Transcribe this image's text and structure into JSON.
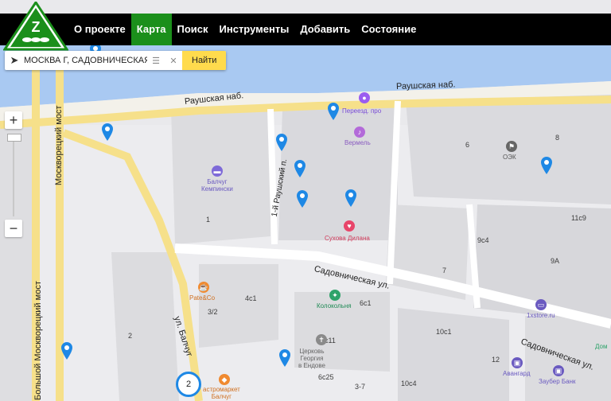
{
  "nav": {
    "items": [
      "О проекте",
      "Карта",
      "Поиск",
      "Инструменты",
      "Добавить",
      "Состояние"
    ],
    "active_index": 1
  },
  "search": {
    "value": "МОСКВА Г, САДОВНИЧЕСКАЯ",
    "button_label": "Найти"
  },
  "zoom": {
    "plus": "+",
    "minus": "−"
  },
  "map": {
    "streets": {
      "raushskaya_1": "Раушская наб.",
      "raushskaya_2": "Раушская наб.",
      "bolshoy_mosk": "Большой Москворецкий мост",
      "moskvoretsky": "Москворецкий мост",
      "raushsky_per": "1-й Раушский п.",
      "sadovnicheskaya_1": "Садовническая ул.",
      "sadovnicheskaya_2": "Садовническая ул.",
      "balchug": "ул. Балчуг"
    },
    "pois": {
      "pereezd": "Переезд. про",
      "vermel": "Вермель",
      "baltchug_kempinski": "Балчуг\nКемпински",
      "sukhova": "Сухова Дилана",
      "pate": "Pate&Co",
      "kolokolnya": "Колокольня",
      "church": "Церковь\nГеоргия\nв Ендове",
      "gastro": "астромаркет\nБалчуг",
      "oek": "ОЭК",
      "avangard": "Авангард",
      "zauber": "Заубер Банк",
      "store1x": "1xstore.ru",
      "dom": "Дом"
    },
    "house_numbers": {
      "h1": "1",
      "h2": "2",
      "h32": "3/2",
      "h4c1": "4с1",
      "h6": "6",
      "h8": "8",
      "h11c9": "11с9",
      "h9c4": "9с4",
      "h9a": "9А",
      "h7": "7",
      "h6c1": "6с1",
      "h10c1": "10с1",
      "h6c11": "6с11",
      "h6c25": "6с25",
      "h37": "3-7",
      "h10c4": "10с4",
      "h12": "12"
    },
    "cluster_count": "2",
    "colors": {
      "water": "#a9c9f2",
      "embankment": "#f5f0d8",
      "road_yellow": "#f6e08a",
      "building": "#dcdcdf",
      "pin": "#1e88e5"
    }
  }
}
